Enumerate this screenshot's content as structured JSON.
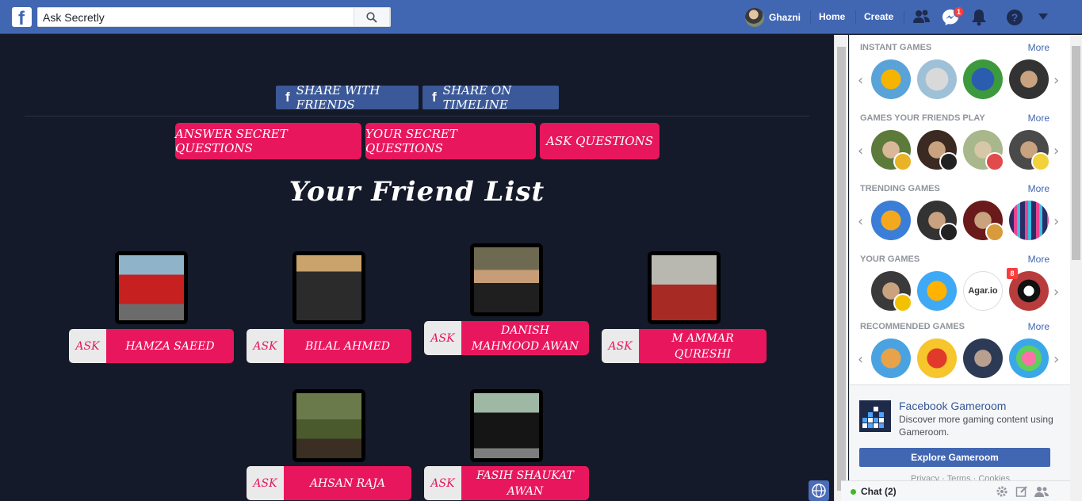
{
  "header": {
    "logo": "f",
    "search_value": "Ask Secretly",
    "user_name": "Ghazni",
    "home": "Home",
    "create": "Create",
    "messenger_badge": "1"
  },
  "share": {
    "with_friends": "SHARE WITH FRIENDS",
    "on_timeline": "SHARE ON TIMELINE"
  },
  "tabs": {
    "answer": "ANSWER SECRET QUESTIONS",
    "yours": "YOUR SECRET QUESTIONS",
    "ask": "ASK QUESTIONS"
  },
  "heading": "Your Friend List",
  "ask_label": "ASK",
  "friends": [
    {
      "name": "HAMZA SAEED"
    },
    {
      "name": "BILAL AHMED"
    },
    {
      "name": "DANISH MAHMOOD AWAN"
    },
    {
      "name": "M AMMAR QURESHI"
    },
    {
      "name": "AHSAN RAJA"
    },
    {
      "name": "FASIH SHAUKAT AWAN"
    }
  ],
  "sidebar": {
    "more": "More",
    "sections": [
      {
        "title": "INSTANT GAMES"
      },
      {
        "title": "GAMES YOUR FRIENDS PLAY"
      },
      {
        "title": "TRENDING GAMES"
      },
      {
        "title": "YOUR GAMES",
        "badge": "8"
      },
      {
        "title": "RECOMMENDED GAMES"
      }
    ],
    "agar_label": "Agar.io",
    "gameroom": {
      "title": "Facebook Gameroom",
      "desc": "Discover more gaming content using Gameroom.",
      "button": "Explore Gameroom",
      "links": "Privacy · Terms · Cookies"
    }
  },
  "chat": {
    "label": "Chat (2)"
  },
  "colors": {
    "brand": "#4267b2",
    "accent": "#e8175d",
    "background": "#141a29"
  }
}
